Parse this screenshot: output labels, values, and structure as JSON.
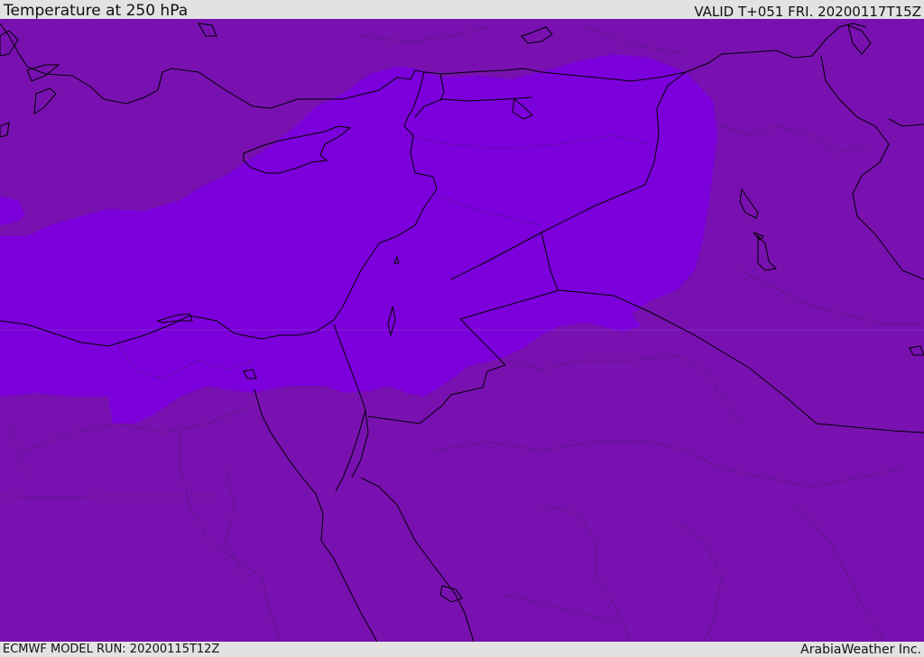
{
  "header": {
    "title": "Temperature at 250 hPa",
    "valid": "VALID T+051 FRI. 20200117T15Z"
  },
  "footer": {
    "model_run": "ECMWF MODEL RUN: 20200115T12Z",
    "credit": "ArabiaWeather Inc."
  },
  "map": {
    "field": "temperature",
    "level": "250 hPa",
    "colors": {
      "background_band": "#7811b0",
      "cold_band": "#7b00db",
      "coastline": "#000000",
      "bar_background": "#e2e2e2"
    }
  }
}
